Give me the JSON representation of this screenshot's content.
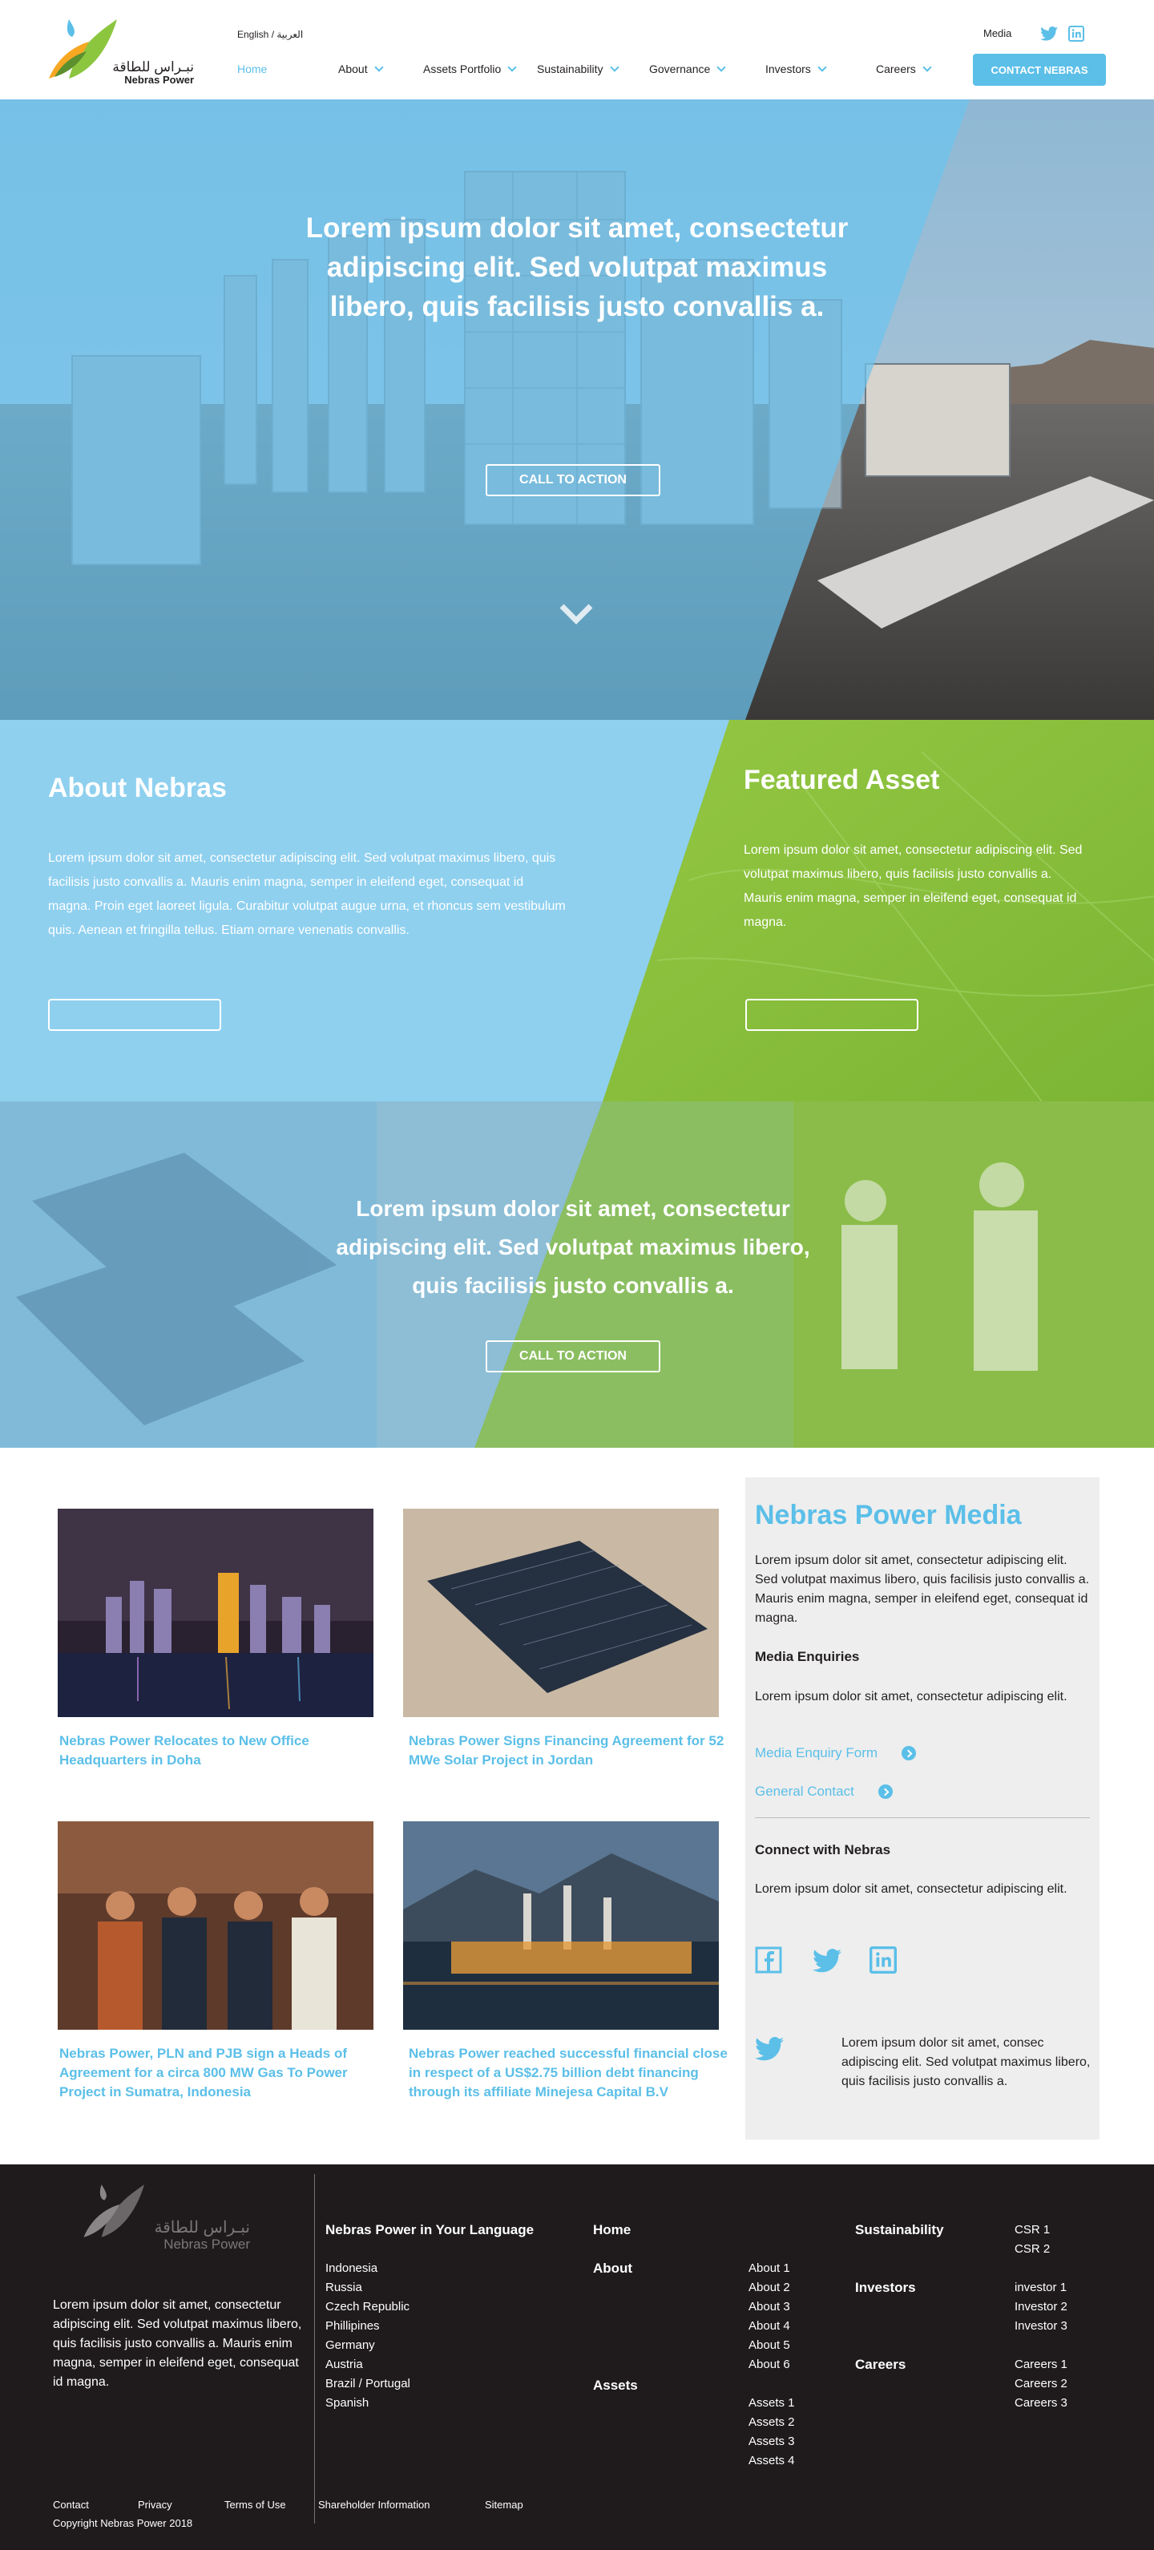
{
  "header": {
    "logo": {
      "arabic": "نبـراس للطاقة",
      "name": "Nebras Power"
    },
    "lang_english": "English /",
    "lang_arabic": "العربية",
    "media_label": "Media",
    "contact_button": "CONTACT NEBRAS",
    "nav": [
      {
        "label": "Home",
        "active": true
      },
      {
        "label": "About"
      },
      {
        "label": "Assets Portfolio"
      },
      {
        "label": "Sustainability"
      },
      {
        "label": "Governance"
      },
      {
        "label": "Investors"
      },
      {
        "label": "Careers"
      }
    ]
  },
  "hero": {
    "headline": "Lorem ipsum dolor sit amet, consectetur adipiscing elit. Sed volutpat maximus libero, quis facilisis justo convallis a.",
    "cta": "CALL TO ACTION"
  },
  "about": {
    "title": "About Nebras",
    "body": "Lorem ipsum dolor sit amet, consectetur adipiscing elit. Sed volutpat maximus libero, quis facilisis justo convallis a. Mauris enim magna, semper in eleifend eget, consequat id magna. Proin eget laoreet ligula. Curabitur volutpat augue urna, et rhoncus sem vestibulum quis. Aenean et fringilla tellus. Etiam ornare venenatis convallis."
  },
  "featured": {
    "title": "Featured Asset",
    "body": "Lorem ipsum dolor sit amet, consectetur adipiscing elit. Sed volutpat maximus libero, quis facilisis justo convallis a. Mauris enim magna, semper in eleifend eget, consequat id magna."
  },
  "banner2": {
    "headline": "Lorem ipsum dolor sit amet, consectetur adipiscing elit. Sed volutpat maximus libero, quis facilisis justo convallis a.",
    "cta": "CALL TO ACTION"
  },
  "news": [
    {
      "caption": "Nebras Power Relocates to New Office Headquarters in Doha"
    },
    {
      "caption": "Nebras Power Signs Financing Agreement for 52 MWe Solar Project in Jordan"
    },
    {
      "caption": "Nebras Power, PLN and PJB sign a Heads of Agreement for a circa 800 MW Gas To Power Project in Sumatra, Indonesia"
    },
    {
      "caption": "Nebras Power reached successful financial close in respect of a US$2.75 billion debt financing through its affiliate Minejesa Capital B.V"
    }
  ],
  "media_panel": {
    "title": "Nebras Power Media",
    "intro": "Lorem ipsum dolor sit amet, consectetur adipiscing elit. Sed volutpat maximus libero, quis facilisis justo convallis a. Mauris enim magna, semper in eleifend eget, consequat id magna.",
    "enquiries_title": "Media Enquiries",
    "enquiries_text": "Lorem ipsum dolor sit amet, consectetur adipiscing elit.",
    "link1": "Media Enquiry Form",
    "link2": "General Contact",
    "connect_title": "Connect with Nebras",
    "connect_text": "Lorem ipsum dolor sit amet, consectetur adipiscing elit.",
    "tweet": "Lorem ipsum dolor sit amet, consec adipiscing elit. Sed volutpat maximus libero, quis facilisis justo convallis a."
  },
  "footer": {
    "logo_arabic": "نبـراس للطاقة",
    "logo_name": "Nebras Power",
    "about_text": "Lorem ipsum dolor sit amet, consectetur adipiscing elit. Sed volutpat maximus libero, quis facilisis justo convallis a. Mauris enim magna, semper in eleifend eget, consequat id magna.",
    "lang_title": "Nebras Power in Your Language",
    "languages": [
      "Indonesia",
      "Russia",
      "Czech Republic",
      "Phillipines",
      "Germany",
      "Austria",
      "Brazil / Portugal",
      "Spanish"
    ],
    "home": "Home",
    "about": "About",
    "about_links": [
      "About 1",
      "About 2",
      "About 3",
      "About 4",
      "About 5",
      "About 6"
    ],
    "assets": "Assets",
    "assets_links": [
      "Assets 1",
      "Assets 2",
      "Assets 3",
      "Assets 4"
    ],
    "sustainability": "Sustainability",
    "csr_links": [
      "CSR 1",
      "CSR 2"
    ],
    "investors": "Investors",
    "investor_links": [
      "investor 1",
      "Investor 2",
      "Investor 3"
    ],
    "careers": "Careers",
    "career_links": [
      "Careers 1",
      "Careers 2",
      "Careers 3"
    ],
    "bottom_links": [
      "Contact",
      "Privacy",
      "Terms of Use",
      "Shareholder Information",
      "Sitemap"
    ],
    "copyright": "Copyright Nebras Power 2018"
  },
  "colors": {
    "accent": "#5bbfe8",
    "green": "#8cc63f",
    "footer_bg": "#1f1b1c",
    "panel_bg": "#eeeeee"
  }
}
